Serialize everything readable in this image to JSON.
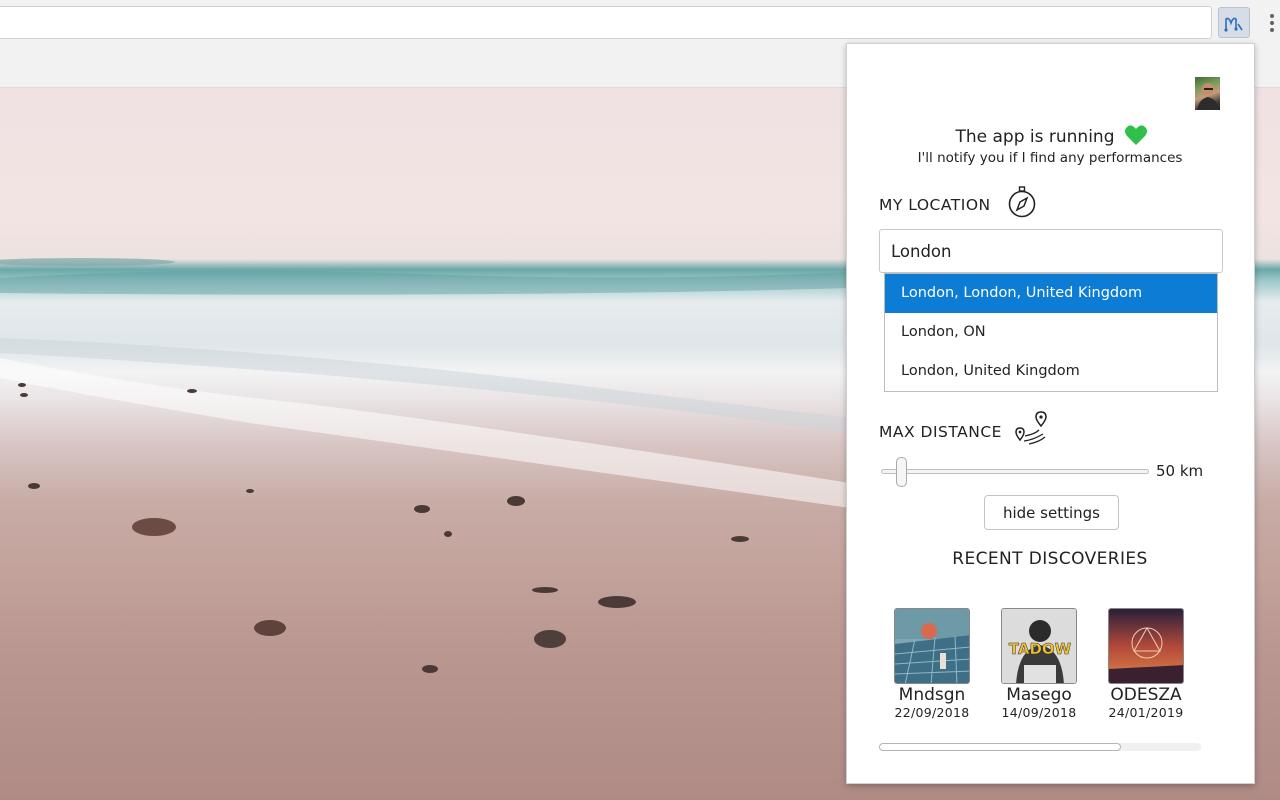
{
  "browser": {
    "extension_icon": "music-note-map-icon",
    "menu_icon": "vertical-ellipsis-icon"
  },
  "popup": {
    "avatar_icon": "user-avatar",
    "status": {
      "title": "The app is running",
      "subtitle": "I'll notify you if I find any performances",
      "icon": "heart-icon",
      "icon_color": "#2fbf4a"
    },
    "location": {
      "label": "MY LOCATION",
      "icon": "compass-icon",
      "input_value": "London",
      "suggestions": [
        {
          "label": "London, London, United Kingdom",
          "selected": true
        },
        {
          "label": "London, ON",
          "selected": false
        },
        {
          "label": "London, United Kingdom",
          "selected": false
        }
      ],
      "highlight_color": "#0c7cd5"
    },
    "distance": {
      "label": "MAX DISTANCE",
      "icon": "route-pin-icon",
      "value_label": "50 km",
      "slider_fraction": 0.06
    },
    "hide_settings_label": "hide settings",
    "recent": {
      "title": "RECENT DISCOVERIES",
      "items": [
        {
          "artist": "Mndsgn",
          "date": "22/09/2018"
        },
        {
          "artist": "Masego",
          "date": "14/09/2018",
          "cover_text": "TADOW"
        },
        {
          "artist": "ODESZA",
          "date": "24/01/2019"
        }
      ],
      "progress_fraction": 0.75
    }
  }
}
